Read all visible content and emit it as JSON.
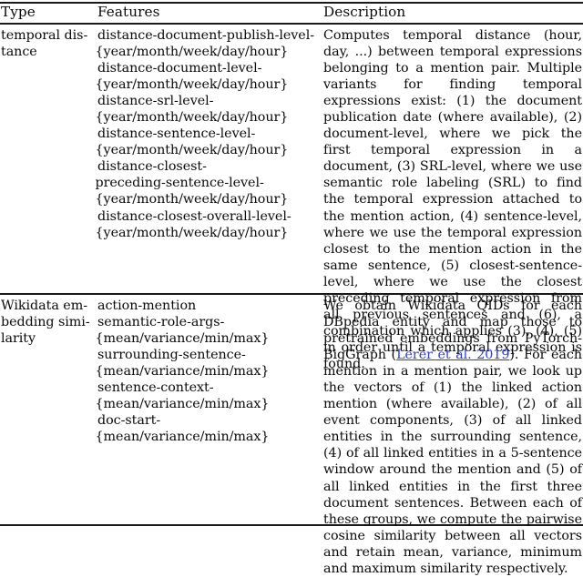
{
  "table": {
    "headers": {
      "type": "Type",
      "features": "Features",
      "description": "Description"
    },
    "rows": [
      {
        "type": "temporal dis­ tance",
        "type_line1": "temporal dis-",
        "type_line2": "tance",
        "features": [
          "distance-document-publish-level-",
          "{year/month/week/day/hour}",
          "distance-document-level-",
          "{year/month/week/day/hour}",
          "distance-srl-level-",
          "{year/month/week/day/hour}",
          "distance-sentence-level-",
          "{year/month/week/day/hour}",
          "distance-closest-",
          "preceding-sentence-level-",
          "{year/month/week/day/hour}",
          "distance-closest-overall-level-",
          "{year/month/week/day/hour}"
        ],
        "description": "Computes temporal distance (hour, day, ...) between temporal expressions belonging to a mention pair. Multiple variants for finding temporal expressions exist: (1) the document publication date (where available), (2) document-level, where we pick the first temporal expression in a document, (3) SRL-level, where we use semantic role labeling (SRL) to find the temporal expression attached to the mention action, (4) sentence-level, where we use the temporal expression closest to the mention action in the same sentence, (5) closest-sentence-level, where we use the closest preceding temporal expression from all previous sentences and (6), a combination which applies (3), (4), (5) in order until a temporal expression is found."
      },
      {
        "type": "Wikidata embedding similarity",
        "type_line1": "Wikidata em-",
        "type_line2": "bedding simi-",
        "type_line3": "larity",
        "features": [
          "action-mention",
          "semantic-role-args-",
          "{mean/variance/min/max}",
          "surrounding-sentence-",
          "{mean/variance/min/max}",
          "sentence-context-",
          "{mean/variance/min/max}",
          "doc-start-",
          "{mean/variance/min/max}"
        ],
        "description_part1": "We obtain Wikidata QIDs for each DBpedia entity and map those to pretrained embeddings from PyTorch-BigGraph (",
        "description_citation": "Lerer et al. 2019",
        "description_part2": "). For each mention in a mention pair, we look up the vectors of (1) the linked action mention (where available), (2) of all event components, (3) of all linked entities in the surrounding sentence, (4) of all linked entities in a 5-sentence window around the mention and (5) of all linked entities in the first three document sentences. Between each of these groups, we compute the pairwise cosine similarity between all vectors and retain mean, variance, minimum and maximum similarity respectively."
      }
    ]
  },
  "colors": {
    "text": "#0a0a0a",
    "rule": "#1a1a1a",
    "citation_link": "#2a3fd0",
    "background": "#ffffff"
  }
}
